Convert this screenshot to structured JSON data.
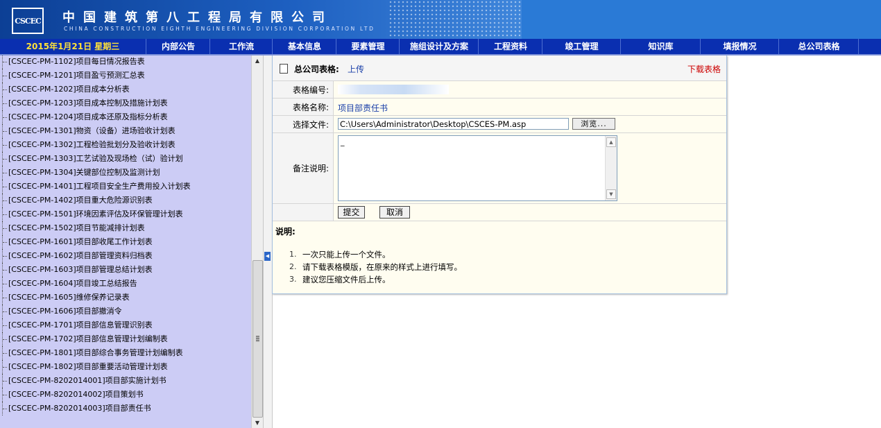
{
  "header": {
    "logo_text": "CSCEC",
    "title_cn": "中国建筑第八工程局有限公司",
    "title_en": "CHINA CONSTRUCTION EIGHTH ENGINEERING DIVISION CORPORATION LTD"
  },
  "nav": {
    "date": "2015年1月21日 星期三",
    "items": [
      {
        "label": "内部公告"
      },
      {
        "label": "工作流"
      },
      {
        "label": "基本信息"
      },
      {
        "label": "要素管理"
      },
      {
        "label": "施组设计及方案"
      },
      {
        "label": "工程资料"
      },
      {
        "label": "竣工管理"
      },
      {
        "label": "知识库"
      },
      {
        "label": "填报情况"
      },
      {
        "label": "总公司表格"
      }
    ]
  },
  "sidebar": {
    "items": [
      {
        "label": "[CSCEC-PM-1102]项目每日情况报告表"
      },
      {
        "label": "[CSCEC-PM-1201]项目盈亏预测汇总表"
      },
      {
        "label": "[CSCEC-PM-1202]项目成本分析表"
      },
      {
        "label": "[CSCEC-PM-1203]项目成本控制及措施计划表"
      },
      {
        "label": "[CSCEC-PM-1204]项目成本还原及指标分析表"
      },
      {
        "label": "[CSCEC-PM-1301]物资（设备）进场验收计划表"
      },
      {
        "label": "[CSCEC-PM-1302]工程检验批划分及验收计划表"
      },
      {
        "label": "[CSCEC-PM-1303]工艺试验及现场检（试）验计划"
      },
      {
        "label": "[CSCEC-PM-1304]关键部位控制及监测计划"
      },
      {
        "label": "[CSCEC-PM-1401]工程项目安全生产费用投入计划表"
      },
      {
        "label": "[CSCEC-PM-1402]项目重大危险源识别表"
      },
      {
        "label": "[CSCEC-PM-1501]环境因素评估及环保管理计划表"
      },
      {
        "label": "[CSCEC-PM-1502]项目节能减排计划表"
      },
      {
        "label": "[CSCEC-PM-1601]项目部收尾工作计划表"
      },
      {
        "label": "[CSCEC-PM-1602]项目部管理资料归档表"
      },
      {
        "label": "[CSCEC-PM-1603]项目部管理总结计划表"
      },
      {
        "label": "[CSCEC-PM-1604]项目竣工总结报告"
      },
      {
        "label": "[CSCEC-PM-1605]维修保养记录表"
      },
      {
        "label": "[CSCEC-PM-1606]项目部撤消令"
      },
      {
        "label": "[CSCEC-PM-1701]项目部信息管理识别表"
      },
      {
        "label": "[CSCEC-PM-1702]项目部信息管理计划编制表"
      },
      {
        "label": "[CSCEC-PM-1801]项目部综合事务管理计划编制表"
      },
      {
        "label": "[CSCEC-PM-1802]项目部重要活动管理计划表"
      },
      {
        "label": "[CSCEC-PM-8202014001]项目部实施计划书"
      },
      {
        "label": "[CSCEC-PM-8202014002]项目策划书"
      },
      {
        "label": "[CSCEC-PM-8202014003]项目部责任书"
      }
    ]
  },
  "panel": {
    "label": "总公司表格:",
    "action": "上传",
    "download": "下载表格",
    "fields": {
      "code_label": "表格编号:",
      "code_value": "",
      "name_label": "表格名称:",
      "name_value": "项目部责任书",
      "file_label": "选择文件:",
      "file_value": "C:\\Users\\Administrator\\Desktop\\CSCES-PM.asp",
      "browse": "浏览...",
      "remark_label": "备注说明:",
      "remark_value": "_"
    },
    "submit": "提交",
    "cancel": "取消",
    "instructions": {
      "title": "说明:",
      "items": [
        {
          "num": "1.",
          "text": "一次只能上传一个文件。"
        },
        {
          "num": "2.",
          "text": "请下载表格模版，在原来的样式上进行填写。"
        },
        {
          "num": "3.",
          "text": "建议您压缩文件后上传。"
        }
      ]
    }
  },
  "colors": {
    "nav_bg": "#0a2fb0",
    "date_text": "#ffe23a",
    "sidebar_bg": "#ccccf5",
    "panel_bg": "#fffdf0",
    "download_link": "#cc0000"
  }
}
